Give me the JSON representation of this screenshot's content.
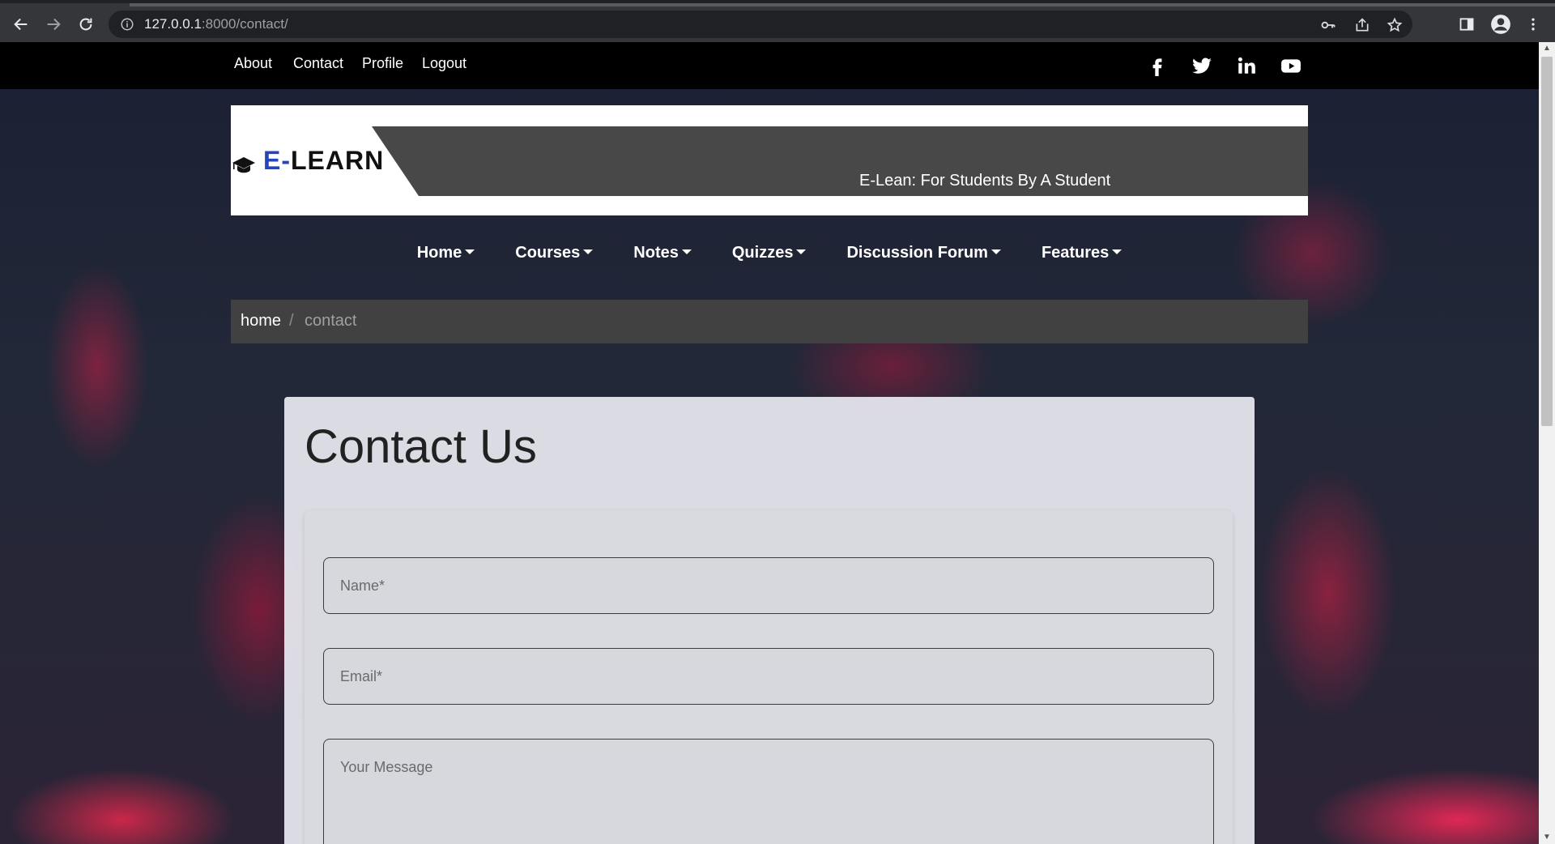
{
  "browser": {
    "url_host": "127.0.0.1",
    "url_rest": ":8000/contact/"
  },
  "topbar": {
    "links": [
      "About",
      "Contact",
      "Profile",
      "Logout"
    ],
    "social_icons": [
      "facebook-icon",
      "twitter-icon",
      "linkedin-icon",
      "youtube-icon"
    ]
  },
  "banner": {
    "logo_prefix": "E-",
    "logo_main": "LEARN",
    "tagline": "E-Lean: For Students By A Student"
  },
  "nav": {
    "items": [
      "Home",
      "Courses",
      "Notes",
      "Quizzes",
      "Discussion Forum",
      "Features"
    ]
  },
  "breadcrumb": {
    "home": "home",
    "separator": "/",
    "current": "contact"
  },
  "contact": {
    "title": "Contact Us",
    "name_placeholder": "Name*",
    "email_placeholder": "Email*",
    "message_placeholder": "Your Message"
  },
  "colors": {
    "logo_accent": "#2645b8",
    "topbar_bg": "#000000",
    "banner_dark": "#484848"
  }
}
